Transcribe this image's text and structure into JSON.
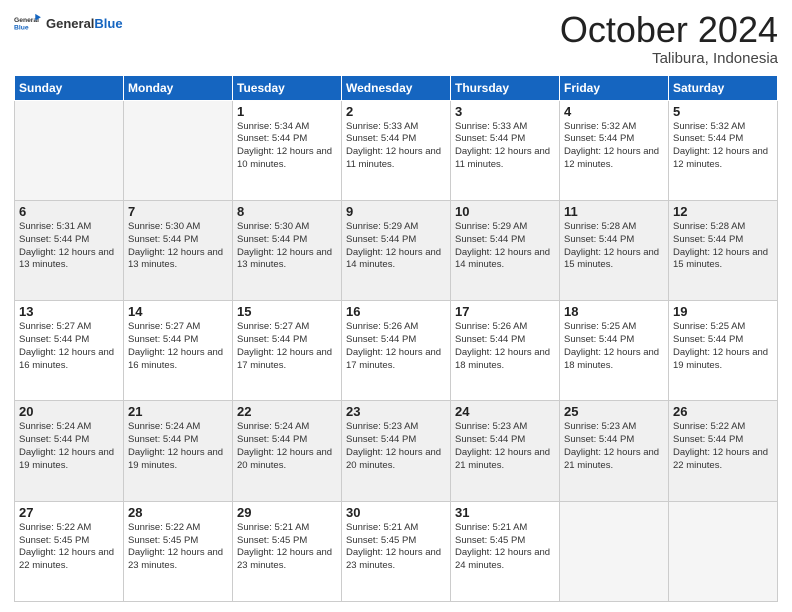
{
  "header": {
    "logo_general": "General",
    "logo_blue": "Blue",
    "month": "October 2024",
    "location": "Talibura, Indonesia"
  },
  "days_of_week": [
    "Sunday",
    "Monday",
    "Tuesday",
    "Wednesday",
    "Thursday",
    "Friday",
    "Saturday"
  ],
  "weeks": [
    [
      {
        "day": "",
        "info": ""
      },
      {
        "day": "",
        "info": ""
      },
      {
        "day": "1",
        "info": "Sunrise: 5:34 AM\nSunset: 5:44 PM\nDaylight: 12 hours and 10 minutes."
      },
      {
        "day": "2",
        "info": "Sunrise: 5:33 AM\nSunset: 5:44 PM\nDaylight: 12 hours and 11 minutes."
      },
      {
        "day": "3",
        "info": "Sunrise: 5:33 AM\nSunset: 5:44 PM\nDaylight: 12 hours and 11 minutes."
      },
      {
        "day": "4",
        "info": "Sunrise: 5:32 AM\nSunset: 5:44 PM\nDaylight: 12 hours and 12 minutes."
      },
      {
        "day": "5",
        "info": "Sunrise: 5:32 AM\nSunset: 5:44 PM\nDaylight: 12 hours and 12 minutes."
      }
    ],
    [
      {
        "day": "6",
        "info": "Sunrise: 5:31 AM\nSunset: 5:44 PM\nDaylight: 12 hours and 13 minutes."
      },
      {
        "day": "7",
        "info": "Sunrise: 5:30 AM\nSunset: 5:44 PM\nDaylight: 12 hours and 13 minutes."
      },
      {
        "day": "8",
        "info": "Sunrise: 5:30 AM\nSunset: 5:44 PM\nDaylight: 12 hours and 13 minutes."
      },
      {
        "day": "9",
        "info": "Sunrise: 5:29 AM\nSunset: 5:44 PM\nDaylight: 12 hours and 14 minutes."
      },
      {
        "day": "10",
        "info": "Sunrise: 5:29 AM\nSunset: 5:44 PM\nDaylight: 12 hours and 14 minutes."
      },
      {
        "day": "11",
        "info": "Sunrise: 5:28 AM\nSunset: 5:44 PM\nDaylight: 12 hours and 15 minutes."
      },
      {
        "day": "12",
        "info": "Sunrise: 5:28 AM\nSunset: 5:44 PM\nDaylight: 12 hours and 15 minutes."
      }
    ],
    [
      {
        "day": "13",
        "info": "Sunrise: 5:27 AM\nSunset: 5:44 PM\nDaylight: 12 hours and 16 minutes."
      },
      {
        "day": "14",
        "info": "Sunrise: 5:27 AM\nSunset: 5:44 PM\nDaylight: 12 hours and 16 minutes."
      },
      {
        "day": "15",
        "info": "Sunrise: 5:27 AM\nSunset: 5:44 PM\nDaylight: 12 hours and 17 minutes."
      },
      {
        "day": "16",
        "info": "Sunrise: 5:26 AM\nSunset: 5:44 PM\nDaylight: 12 hours and 17 minutes."
      },
      {
        "day": "17",
        "info": "Sunrise: 5:26 AM\nSunset: 5:44 PM\nDaylight: 12 hours and 18 minutes."
      },
      {
        "day": "18",
        "info": "Sunrise: 5:25 AM\nSunset: 5:44 PM\nDaylight: 12 hours and 18 minutes."
      },
      {
        "day": "19",
        "info": "Sunrise: 5:25 AM\nSunset: 5:44 PM\nDaylight: 12 hours and 19 minutes."
      }
    ],
    [
      {
        "day": "20",
        "info": "Sunrise: 5:24 AM\nSunset: 5:44 PM\nDaylight: 12 hours and 19 minutes."
      },
      {
        "day": "21",
        "info": "Sunrise: 5:24 AM\nSunset: 5:44 PM\nDaylight: 12 hours and 19 minutes."
      },
      {
        "day": "22",
        "info": "Sunrise: 5:24 AM\nSunset: 5:44 PM\nDaylight: 12 hours and 20 minutes."
      },
      {
        "day": "23",
        "info": "Sunrise: 5:23 AM\nSunset: 5:44 PM\nDaylight: 12 hours and 20 minutes."
      },
      {
        "day": "24",
        "info": "Sunrise: 5:23 AM\nSunset: 5:44 PM\nDaylight: 12 hours and 21 minutes."
      },
      {
        "day": "25",
        "info": "Sunrise: 5:23 AM\nSunset: 5:44 PM\nDaylight: 12 hours and 21 minutes."
      },
      {
        "day": "26",
        "info": "Sunrise: 5:22 AM\nSunset: 5:44 PM\nDaylight: 12 hours and 22 minutes."
      }
    ],
    [
      {
        "day": "27",
        "info": "Sunrise: 5:22 AM\nSunset: 5:45 PM\nDaylight: 12 hours and 22 minutes."
      },
      {
        "day": "28",
        "info": "Sunrise: 5:22 AM\nSunset: 5:45 PM\nDaylight: 12 hours and 23 minutes."
      },
      {
        "day": "29",
        "info": "Sunrise: 5:21 AM\nSunset: 5:45 PM\nDaylight: 12 hours and 23 minutes."
      },
      {
        "day": "30",
        "info": "Sunrise: 5:21 AM\nSunset: 5:45 PM\nDaylight: 12 hours and 23 minutes."
      },
      {
        "day": "31",
        "info": "Sunrise: 5:21 AM\nSunset: 5:45 PM\nDaylight: 12 hours and 24 minutes."
      },
      {
        "day": "",
        "info": ""
      },
      {
        "day": "",
        "info": ""
      }
    ]
  ]
}
